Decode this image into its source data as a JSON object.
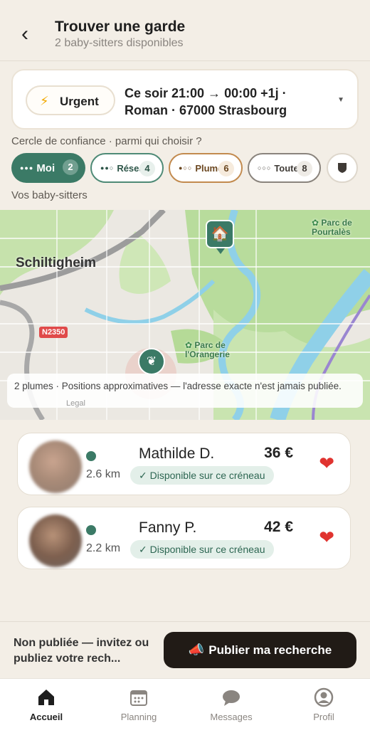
{
  "header": {
    "title": "Trouver une garde",
    "subtitle": "2 baby-sitters disponibles"
  },
  "search": {
    "urgent_label": "Urgent",
    "when_line1": "Ce soir 21:00 → 00:00 +1j ·",
    "when_line2": "Roman · 67000 Strasbourg"
  },
  "circle": {
    "label": "Cercle de confiance · parmi qui choisir ?",
    "chips": [
      {
        "label": "Moi",
        "count": "2"
      },
      {
        "label": "Réseau",
        "count": "4"
      },
      {
        "label": "Plume",
        "count": "6"
      },
      {
        "label": "Toutes",
        "count": "8"
      }
    ]
  },
  "sitters_label": "Vos baby-sitters",
  "map": {
    "city": "Schiltigheim",
    "road": "N2350",
    "park1": "Parc de\nPourtalès",
    "park2": "Parc de\nl'Orangerie",
    "note": "2 plumes · Positions approximatives — l'adresse exacte n'est jamais publiée.",
    "legal": "Legal"
  },
  "sitters": [
    {
      "name": "Mathilde D.",
      "price": "36 €",
      "distance": "2.6 km",
      "availability": "✓ Disponible sur ce créneau"
    },
    {
      "name": "Fanny P.",
      "price": "42 €",
      "distance": "2.2 km",
      "availability": "✓ Disponible sur ce créneau"
    }
  ],
  "bottom": {
    "status": "Non publiée — invitez ou publiez votre rech...",
    "publish_label": "Publier ma recherche"
  },
  "tabs": [
    {
      "label": "Accueil",
      "icon": "home-icon"
    },
    {
      "label": "Planning",
      "icon": "calendar-icon"
    },
    {
      "label": "Messages",
      "icon": "chat-icon"
    },
    {
      "label": "Profil",
      "icon": "user-icon"
    }
  ],
  "colors": {
    "accent": "#3b7a66",
    "plume": "#c28a4e",
    "background": "#f3eee6",
    "button_dark": "#211b16"
  }
}
